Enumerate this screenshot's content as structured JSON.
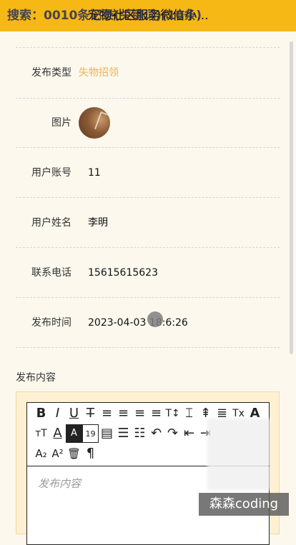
{
  "header": {
    "title": "社区服务微信小...",
    "title_prefix": "宠物",
    "search_overlay": "搜索：0010条记录(关键词)(10条)"
  },
  "form": {
    "rows": [
      {
        "label": "发布类型",
        "value": "失物招领"
      },
      {
        "label": "图片",
        "value": ""
      },
      {
        "label": "用户账号",
        "value": "11"
      },
      {
        "label": "用户姓名",
        "value": "李明"
      },
      {
        "label": "联系电话",
        "value": "15615615623"
      },
      {
        "label": "发布时间",
        "value": "2023-04-03 18:6:26"
      }
    ],
    "content_label": "发布内容",
    "editor_placeholder": "发布内容"
  },
  "toolbar": {
    "row1": [
      "B",
      "I",
      "U",
      "T̶",
      "≡",
      "≡",
      "≡",
      "≡",
      "T↕",
      "⌶",
      "⇞",
      "≣",
      "Tx",
      "A"
    ],
    "row2": [
      "ᴛT",
      "A",
      "A",
      "19",
      "▤",
      "☰",
      "☷",
      "↶",
      "↷",
      "⇤",
      "⇥"
    ],
    "row3": [
      "A₂",
      "A²",
      "🗑",
      "¶"
    ]
  },
  "watermark": "森森coding",
  "colors": {
    "accent": "#e8b457",
    "bar": "#f6b815",
    "bg": "#fdf8ee"
  }
}
